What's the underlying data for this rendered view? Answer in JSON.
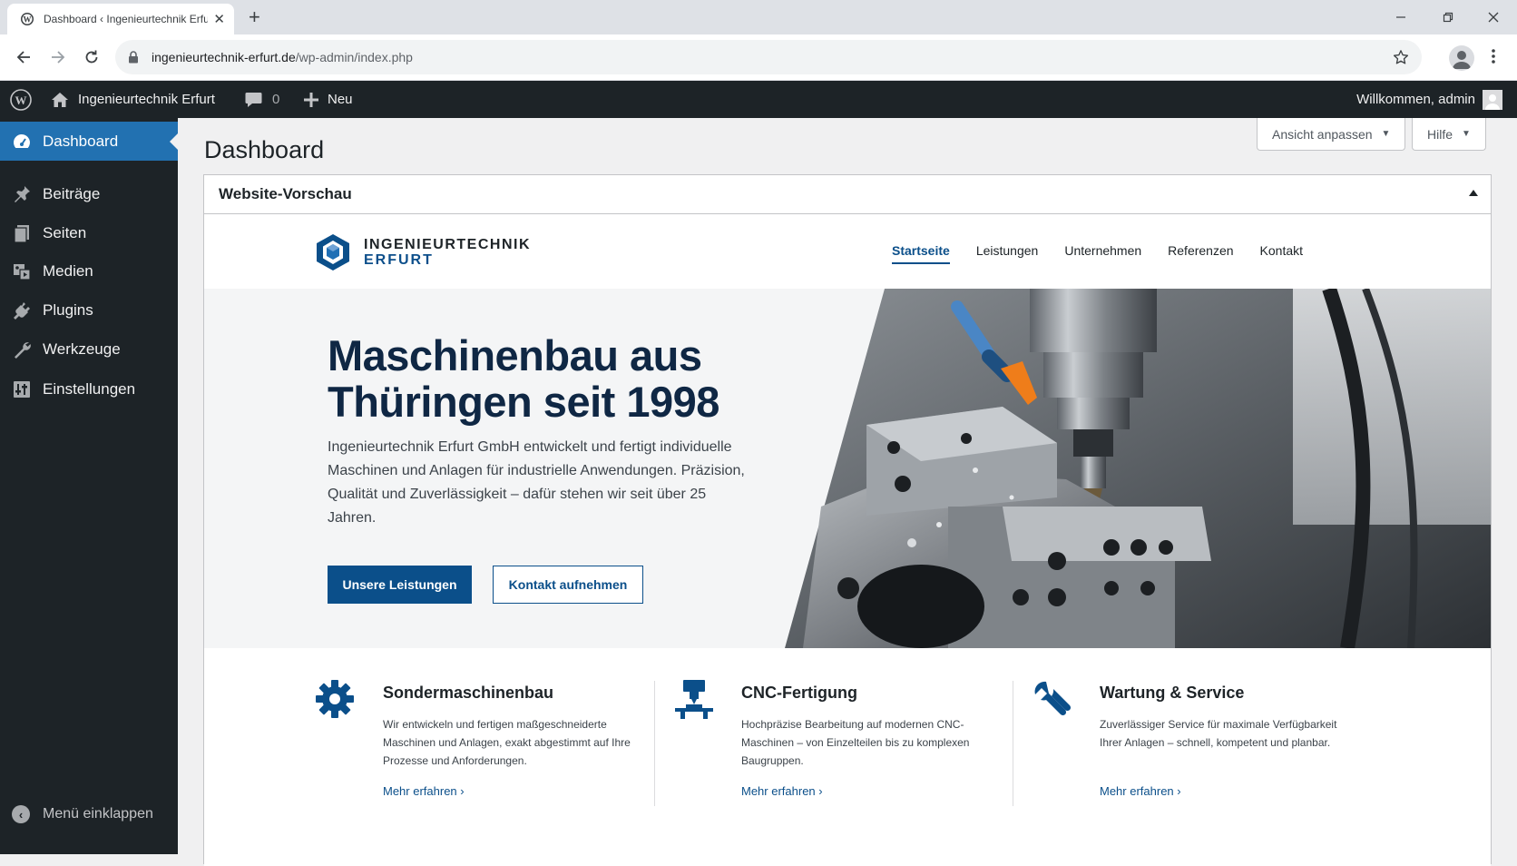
{
  "browser": {
    "tab_title": "Dashboard ‹ Ingenieurtechnik Erfurt",
    "url_host": "ingenieurtechnik-erfurt.de",
    "url_path": "/wp-admin/index.php"
  },
  "adminbar": {
    "site_name": "Ingenieurtechnik Erfurt",
    "comments_count": "0",
    "new_label": "Neu",
    "welcome": "Willkommen, admin"
  },
  "sidebar": {
    "items": [
      {
        "label": "Dashboard",
        "icon": "dashboard-icon",
        "active": true
      },
      {
        "label": "Beiträge",
        "icon": "pin-icon"
      },
      {
        "label": "Seiten",
        "icon": "pages-icon"
      },
      {
        "label": "Medien",
        "icon": "media-icon"
      },
      {
        "label": "Plugins",
        "icon": "plugin-icon"
      },
      {
        "label": "Werkzeuge",
        "icon": "wrench-icon"
      },
      {
        "label": "Einstellungen",
        "icon": "settings-icon"
      }
    ],
    "collapse_label": "Menü einklappen"
  },
  "main": {
    "title": "Dashboard",
    "screen_options": "Ansicht anpassen",
    "help": "Hilfe",
    "widget_title": "Website-Vorschau"
  },
  "preview": {
    "logo_line1": "INGENIEURTECHNIK",
    "logo_line2": "ERFURT",
    "nav": [
      "Startseite",
      "Leistungen",
      "Unternehmen",
      "Referenzen",
      "Kontakt"
    ],
    "hero_title_line1": "Maschinenbau aus",
    "hero_title_line2": "Thüringen seit 1998",
    "hero_text": "Ingenieurtechnik Erfurt GmbH entwickelt und fertigt individuelle Maschinen und Anlagen für industrielle Anwendungen. Präzision, Qualität und Zuverlässigkeit – dafür stehen wir seit über 25 Jahren.",
    "btn_primary": "Unsere Leistungen",
    "btn_secondary": "Kontakt aufnehmen",
    "features": [
      {
        "title": "Sondermaschinenbau",
        "icon": "gear-icon",
        "text": "Wir entwickeln und fertigen maßgeschneiderte Maschinen und Anlagen, exakt abgestimmt auf Ihre Prozesse und Anforderungen.",
        "link": "Mehr erfahren"
      },
      {
        "title": "CNC-Fertigung",
        "icon": "cnc-icon",
        "text": "Hochpräzise Bearbeitung auf modernen CNC-Maschinen – von Einzelteilen bis zu komplexen Baugruppen.",
        "link": "Mehr erfahren"
      },
      {
        "title": "Wartung & Service",
        "icon": "wrench-icon",
        "text": "Zuverlässiger Service für maximale Verfügbarkeit Ihrer Anlagen – schnell, kompetent und planbar.",
        "link": "Mehr erfahren"
      }
    ]
  },
  "colors": {
    "wp_dark": "#1d2327",
    "wp_blue": "#2271b1",
    "brand_blue": "#0b4f8a",
    "hero_title": "#0f2744"
  }
}
